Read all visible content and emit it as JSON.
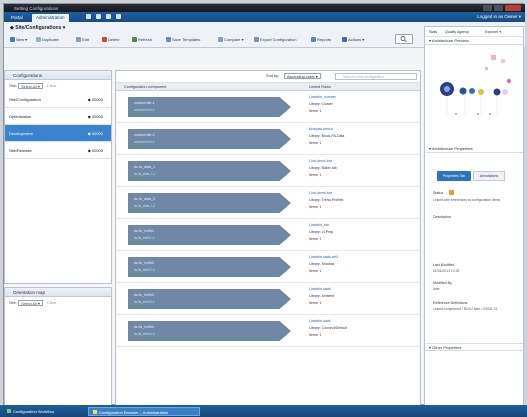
{
  "window": {
    "title": "Setting Configurations",
    "user_info": "Logged in as  Owner ▾"
  },
  "ribbon": {
    "tabs": [
      "Portal",
      "Administration"
    ],
    "active_tab_index": 1
  },
  "toolbar": {
    "breadcrumb": "◆ Site/Configurations ▾",
    "buttons": [
      "New ▾",
      "Duplicate",
      "Edit",
      "Delete",
      "Refresh",
      "Save Templates",
      "Compare ▾",
      "Export Configuration",
      "Reports",
      "Actions ▾"
    ]
  },
  "left_panel": {
    "title": "Configurations",
    "filter_label": "Site:",
    "filter_value": "Select All ▾",
    "filter_extra": "Clear",
    "items": [
      {
        "label": "Site/Configuration",
        "count": "◆ 00000"
      },
      {
        "label": "Optimization",
        "count": "◆ 00000"
      },
      {
        "label": "Development",
        "count": "◆ 00000"
      },
      {
        "label": "Site/Release",
        "count": "◆ 00000"
      }
    ],
    "selected_index": 2,
    "lower_title": "Orientation map",
    "lower_filter_label": "Site:",
    "lower_filter_value": "Select All ▾",
    "lower_filter_extra": "Clear"
  },
  "center_panel": {
    "sort_label": "Sort by:",
    "sort_value": "Ascending order ▾",
    "search_placeholder": "Search in this configuration",
    "col_left": "Configuration component",
    "col_right": "Linked Rows",
    "rows": [
      {
        "name": "custom-file-1",
        "sub": "content-item-1",
        "d1": "Linkable_number",
        "d2": "Library: Cluster",
        "d3": "Items: 1"
      },
      {
        "name": "custom-file-2",
        "sub": "content-item-2",
        "d1": "Analysis-bench",
        "d2": "Library: Block-PA-Data",
        "d3": "Items: 1"
      },
      {
        "name": "fa-1a_data_1",
        "sub": "fa-1a_data-1-1",
        "d1": "Cost-items-bar",
        "d2": "Library: Baker-tab",
        "d3": "Items: 1"
      },
      {
        "name": "fa-1b_data_2",
        "sub": "fa-1b_data-1-2",
        "d1": "Cost-items-bar",
        "d2": "Library: Trend-Profiles",
        "d3": "Items: 1"
      },
      {
        "name": "fa-2b_lnd/b1",
        "sub": "fa-2b_lnd/b1-1",
        "d1": "Linkable_bar",
        "d2": "Library: Lt-Prep",
        "d3": "Items: 1"
      },
      {
        "name": "fa-2b_lnd/b2",
        "sub": "fa-2b_lnd/b2-2",
        "d1": "Linkable-stats-set1",
        "d2": "Library: Shadow",
        "d3": "Items: 1"
      },
      {
        "name": "fa-3c_lnd/b3",
        "sub": "fa-3c_lnd/b3-1",
        "d1": "Linkable-stats",
        "d2": "Library: Ambient",
        "d3": "Items: 1"
      },
      {
        "name": "fa-3d_lnd/b4",
        "sub": "fa-3d_lnd/b4-2",
        "d1": "Linkable-stats",
        "d2": "Library: Connect/Default",
        "d3": "Items: 1"
      }
    ]
  },
  "right_panel": {
    "top_links": [
      "Stats",
      "Quality Agency",
      "Explorer ▾"
    ],
    "section1_title": "▾ Architecture Preview",
    "section2_title": "▾ Architecture Properties",
    "tabs": [
      "Properties Tab",
      "Annotations"
    ],
    "props": [
      {
        "label": "Status",
        "value": "Linked with references to configuration items"
      },
      {
        "label": "Description",
        "value": ""
      },
      {
        "label": "Last Modified",
        "value": "01/01/2014 10:28"
      },
      {
        "label": "Modified By",
        "value": "user"
      },
      {
        "label": "Reference Definitions",
        "value": "Linked-component / RL01/ Item / 00001-01"
      }
    ],
    "section3_title": "▾ Other Properties"
  },
  "taskbar": {
    "tabs": [
      "Configuration Workflow",
      "Configuration Browser – Administration"
    ]
  },
  "colors": {
    "accent": "#2d73bf",
    "selected_row": "#3a83cf",
    "arrow_block": "#6f88a8",
    "ribbon": "#1d5fa3"
  }
}
